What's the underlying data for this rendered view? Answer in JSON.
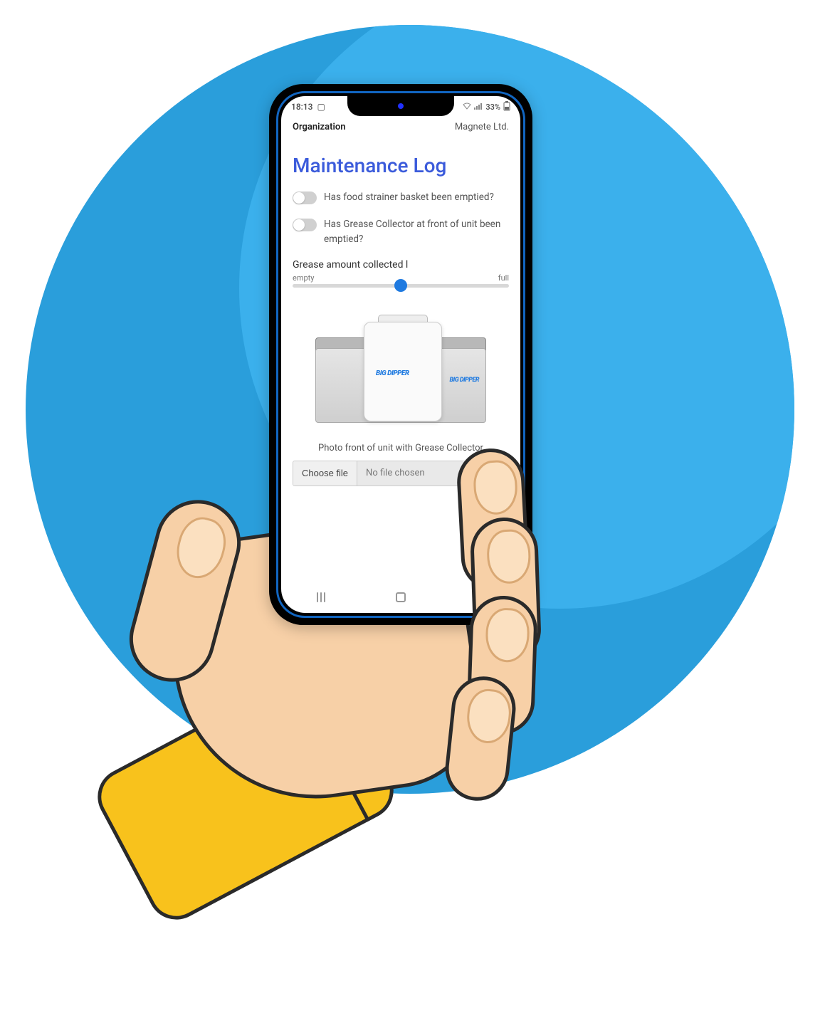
{
  "statusbar": {
    "time": "18:13",
    "battery": "33%"
  },
  "header": {
    "org_label": "Organization",
    "org_name": "Magnete Ltd."
  },
  "page": {
    "title": "Maintenance Log"
  },
  "toggles": {
    "q1": "Has food strainer basket been emptied?",
    "q2": "Has Grease Collector at front of unit been emptied?"
  },
  "slider": {
    "title": "Grease amount collected l",
    "min_label": "empty",
    "max_label": "full",
    "value_percent": 50
  },
  "product": {
    "brand": "BIG DIPPER"
  },
  "photo": {
    "label": "Photo front of unit with Grease Collector",
    "choose_button": "Choose file",
    "status": "No file chosen"
  }
}
